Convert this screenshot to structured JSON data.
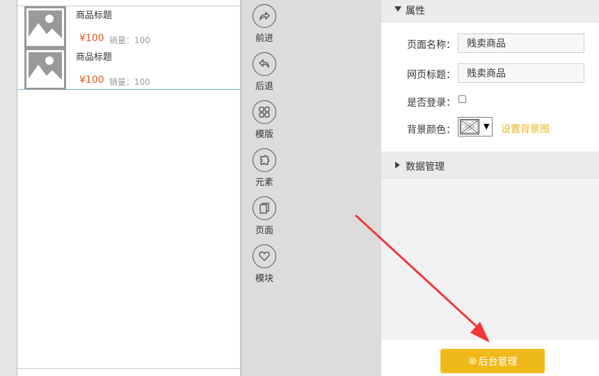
{
  "products": [
    {
      "title": "商品标题",
      "price": "¥100",
      "sales": "销量：100"
    },
    {
      "title": "商品标题",
      "price": "¥100",
      "sales": "销量：100"
    }
  ],
  "toolbar": {
    "items": [
      {
        "label": "前进",
        "icon": "forward-icon"
      },
      {
        "label": "后退",
        "icon": "back-icon"
      },
      {
        "label": "模版",
        "icon": "template-icon"
      },
      {
        "label": "元素",
        "icon": "element-icon"
      },
      {
        "label": "页面",
        "icon": "page-icon"
      },
      {
        "label": "模块",
        "icon": "heart-icon"
      }
    ]
  },
  "panel": {
    "properties_title": "属性",
    "page_name_label": "页面名称：",
    "page_name_value": "贱卖商品",
    "page_title_label": "网页标题：",
    "page_title_value": "贱卖商品",
    "login_label": "是否登录：",
    "bg_color_label": "背景颜色：",
    "bg_image_link": "设置背景图",
    "data_section_title": "数据管理",
    "admin_button_label": "后台管理"
  },
  "colors": {
    "accent": "#efb91a",
    "price": "#e8551f",
    "link": "#e8b420",
    "arrow": "#f0373a"
  }
}
